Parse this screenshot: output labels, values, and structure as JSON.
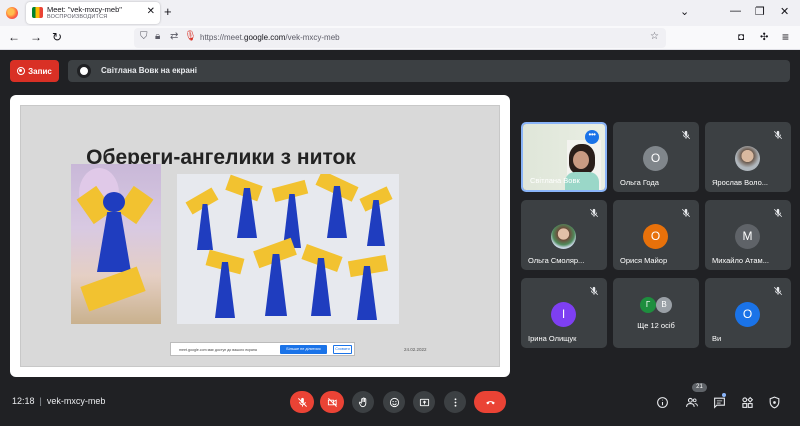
{
  "browser": {
    "tab_title": "Meet: \"vek-mxcy-meb\"",
    "tab_subtitle": "ВОСПРОИЗВОДИТСЯ",
    "url_prefix": "https://meet.",
    "url_domain": "google.com",
    "url_path": "/vek-mxcy-meb"
  },
  "topbar": {
    "record_label": "Запис",
    "presenting_text": "Світлана Вовк на екрані"
  },
  "slide": {
    "title": "Обереги-ангелики з ниток",
    "share_message": "meet.google.com має доступ до вашого екрана",
    "stop_label": "Більше не ділитися",
    "hide_label": "Сховати",
    "date": "24.02.2022"
  },
  "participants": [
    {
      "name": "Світлана Вовк",
      "type": "video",
      "active": true
    },
    {
      "name": "Ольга Года",
      "initial": "О",
      "color": "#80868b"
    },
    {
      "name": "Ярослав Воло...",
      "type": "photo"
    },
    {
      "name": "Ольга Смоляр...",
      "type": "photo"
    },
    {
      "name": "Орися Майор",
      "initial": "О",
      "color": "#e8710a"
    },
    {
      "name": "Михайло Атам...",
      "initial": "М",
      "color": "#5f6368"
    },
    {
      "name": "Ірина Олищук",
      "initial": "І",
      "color": "#7e3ff2"
    },
    {
      "name": "Ще 12 осіб",
      "type": "more",
      "mini": [
        {
          "initial": "Г",
          "color": "#1e8e3e"
        },
        {
          "initial": "В",
          "color": "#9aa0a6"
        }
      ]
    },
    {
      "name": "Ви",
      "initial": "О",
      "color": "#1a73e8"
    }
  ],
  "bottombar": {
    "time": "12:18",
    "meeting_code": "vek-mxcy-meb",
    "participant_count": "21"
  },
  "colors": {
    "accent_red": "#ea4335",
    "accent_blue": "#8ab4f8",
    "tile_bg": "#3c4043"
  }
}
